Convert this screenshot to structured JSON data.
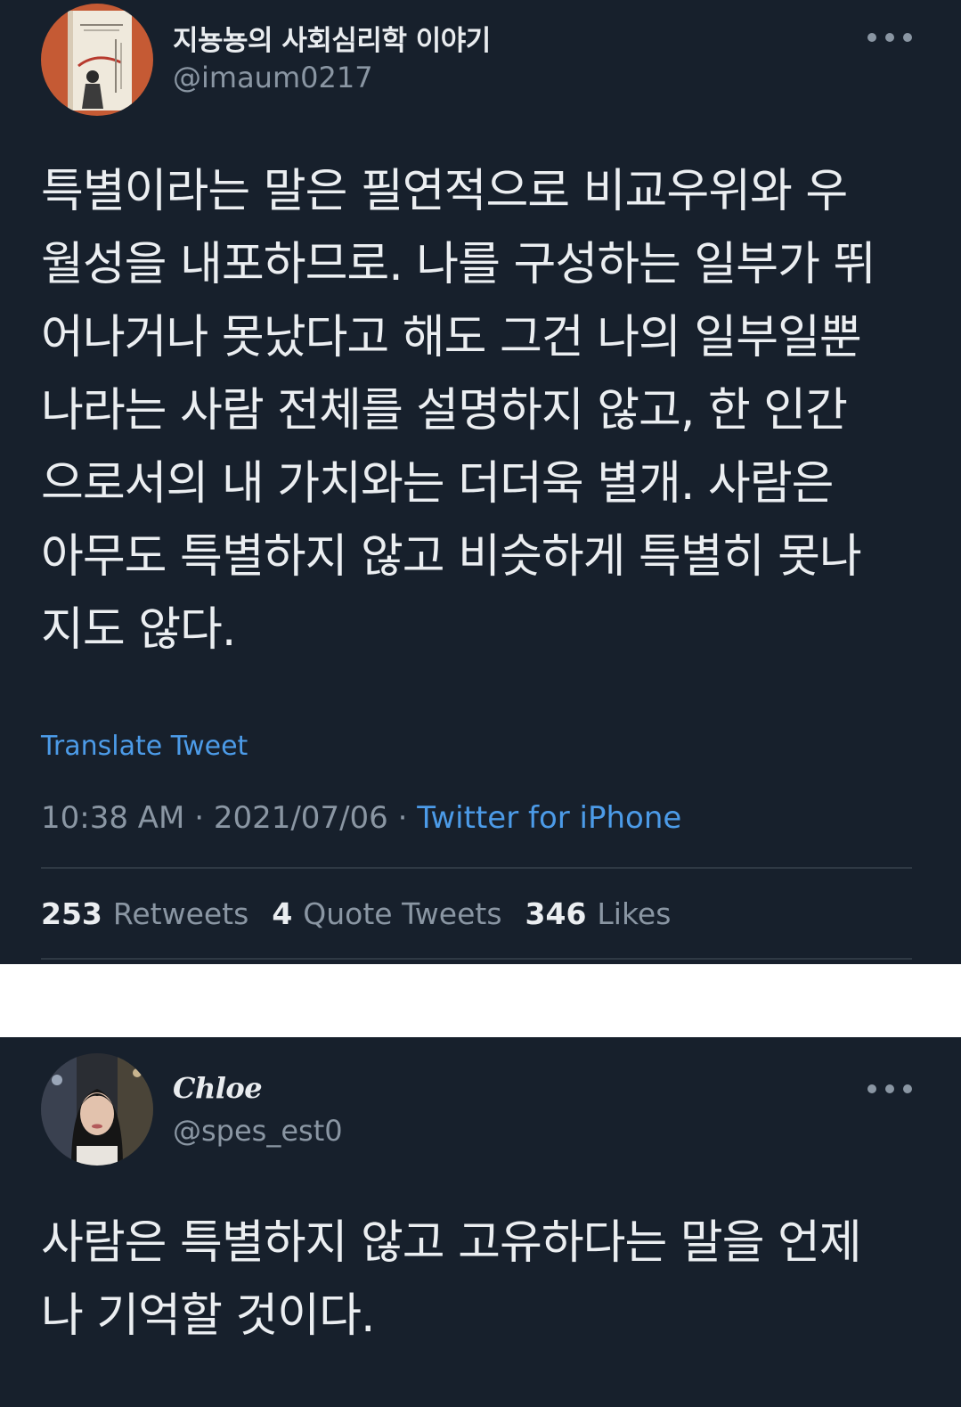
{
  "tweet": {
    "display_name": "지뇽뇽의 사회심리학 이야기",
    "handle": "@imaum0217",
    "text_lines": [
      "특별이라는 말은 필연적으로 비교우위와 우",
      "월성을 내포하므로. 나를 구성하는 일부가 뛰",
      "어나거나 못났다고 해도 그건 나의 일부일뿐",
      "나라는 사람 전체를 설명하지 않고, 한 인간",
      "으로서의 내 가치와는 더더욱 별개. 사람은",
      "아무도 특별하지 않고 비슷하게 특별히 못나",
      "지도 않다."
    ],
    "translate_label": "Translate Tweet",
    "time": "10:38 AM",
    "date": "2021/07/06",
    "separator": "·",
    "source": "Twitter for iPhone",
    "stats": {
      "retweets_count": "253",
      "retweets_label": "Retweets",
      "quotes_count": "4",
      "quotes_label": "Quote Tweets",
      "likes_count": "346",
      "likes_label": "Likes"
    }
  },
  "reply": {
    "display_name": "Chloe",
    "handle": "@spes_est0",
    "text_lines": [
      "사람은 특별하지 않고 고유하다는 말을 언제",
      "나 기억할 것이다."
    ]
  },
  "colors": {
    "background": "#17202c",
    "text": "#ebeef1",
    "secondary": "#8a96a3",
    "link": "#4c9be8"
  }
}
